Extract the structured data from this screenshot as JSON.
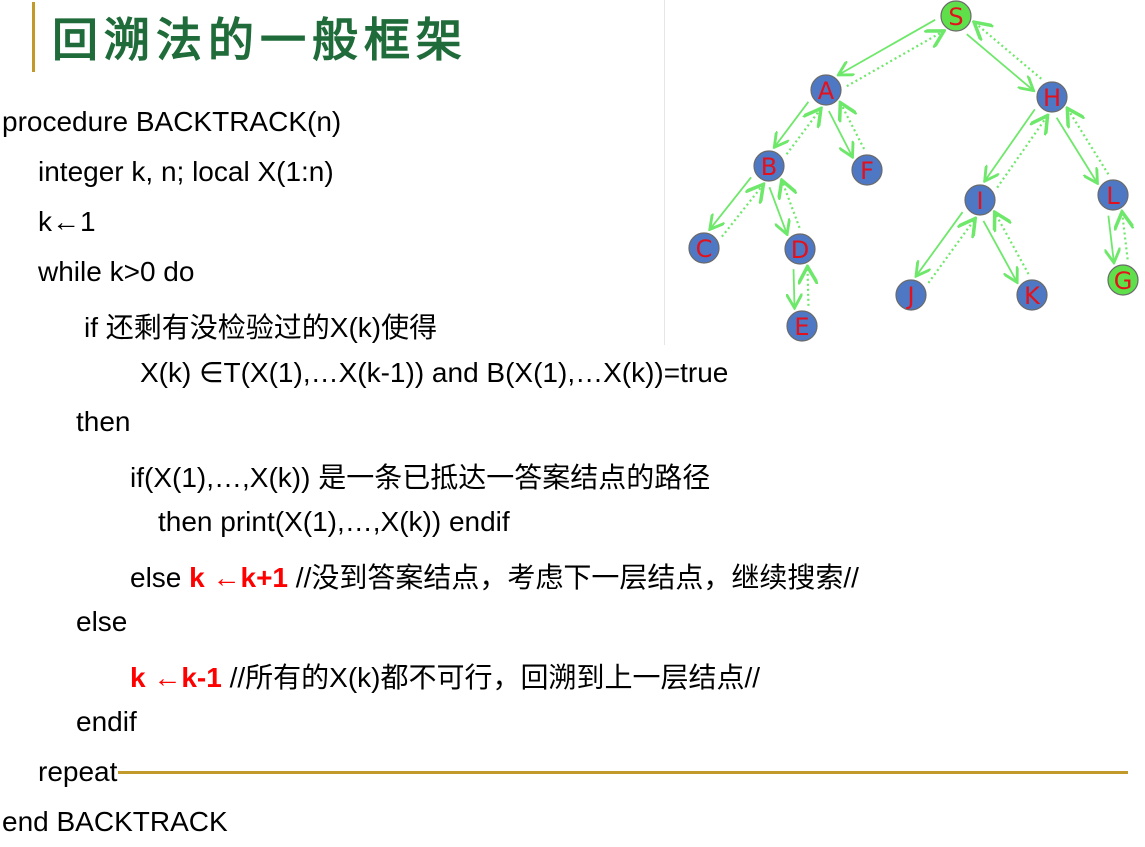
{
  "title": "回溯法的一般框架",
  "code": {
    "l1": "procedure BACKTRACK(n)",
    "l2": "integer k, n; local X(1:n)",
    "l3": "k←1",
    "l4": "while k>0 do",
    "l5": "if 还剩有没检验过的X(k)使得",
    "l6": "X(k) ∈T(X(1),…X(k-1)) and  B(X(1),…X(k))=true",
    "l7": "then",
    "l8": "if(X(1),…,X(k)) 是一条已抵达一答案结点的路径",
    "l9": "then print(X(1),…,X(k)) endif",
    "l10_prefix": "else  ",
    "l10_red": "k ←k+1",
    "l10_comment": "  //没到答案结点，考虑下一层结点，继续搜索//",
    "l11": "else",
    "l12_red": "k ←k-1",
    "l12_comment": "   //所有的X(k)都不可行，回溯到上一层结点//",
    "l13": "endif",
    "l14": "repeat",
    "l15": "end BACKTRACK"
  },
  "tree": {
    "nodes": [
      "S",
      "A",
      "H",
      "B",
      "F",
      "I",
      "L",
      "C",
      "D",
      "J",
      "K",
      "G",
      "E"
    ],
    "goal_nodes": [
      "S",
      "G"
    ],
    "colors": {
      "node_fill": "#4f78c4",
      "goal_fill": "#5fe04a",
      "label": "#e3111b",
      "arrow": "#6ee86a"
    }
  }
}
